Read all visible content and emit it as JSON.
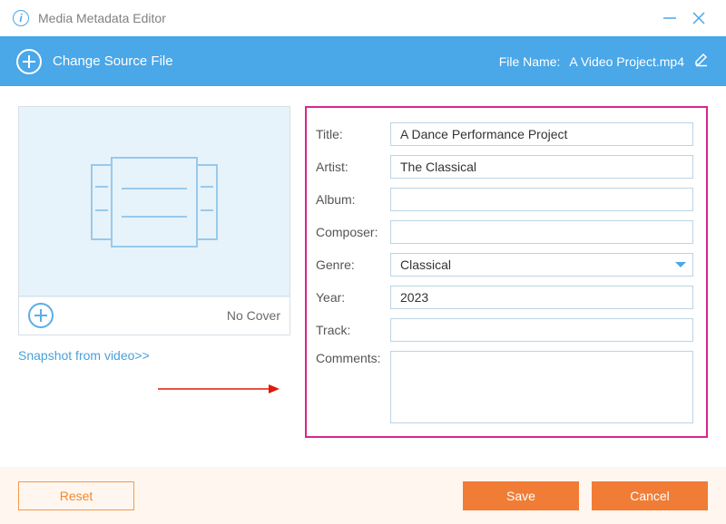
{
  "app": {
    "title": "Media Metadata Editor"
  },
  "toolbar": {
    "change_source_label": "Change Source File",
    "file_name_label": "File Name:",
    "file_name_value": "A Video Project.mp4"
  },
  "cover": {
    "no_cover_label": "No Cover",
    "snapshot_link": "Snapshot from video>>"
  },
  "form": {
    "labels": {
      "title": "Title:",
      "artist": "Artist:",
      "album": "Album:",
      "composer": "Composer:",
      "genre": "Genre:",
      "year": "Year:",
      "track": "Track:",
      "comments": "Comments:"
    },
    "values": {
      "title": "A Dance Performance Project",
      "artist": "The Classical",
      "album": "",
      "composer": "",
      "genre": "Classical",
      "year": "2023",
      "track": "",
      "comments": ""
    }
  },
  "footer": {
    "reset": "Reset",
    "save": "Save",
    "cancel": "Cancel"
  }
}
